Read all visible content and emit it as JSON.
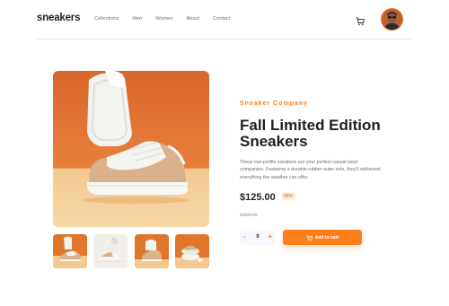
{
  "header": {
    "logo": "sneakers",
    "nav": [
      "Collections",
      "Men",
      "Women",
      "About",
      "Contact"
    ],
    "cart_icon": "cart-icon",
    "avatar": "user-avatar"
  },
  "product": {
    "company": "Sneaker Company",
    "title": "Fall Limited Edition Sneakers",
    "description": "These low-profile sneakers are your perfect casual wear companion. Featuring a durable rubber outer sole, they'll withstand everything the weather can offer.",
    "price": "$125.00",
    "discount": "50%",
    "old_price": "$250.00",
    "quantity": {
      "minus": "-",
      "value": "0",
      "plus": "+"
    },
    "add_to_cart": "Add to cart"
  },
  "gallery": {
    "thumbnail_count": 4
  },
  "colors": {
    "accent": "#ff7e1b",
    "accent_pale": "#ffede0",
    "text_dark": "#1d2026",
    "text_muted": "#69707d",
    "text_light": "#b6bcc8",
    "image_bg": "#e0762a"
  }
}
